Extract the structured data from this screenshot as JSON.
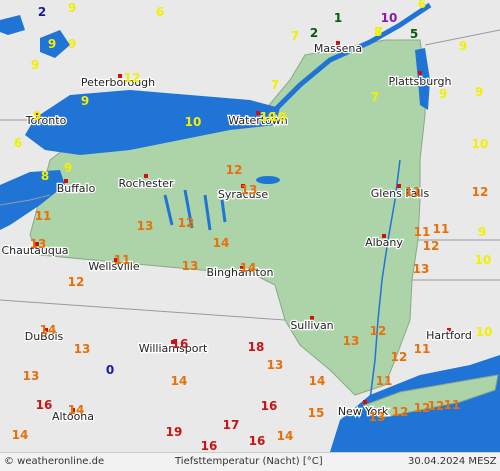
{
  "map": {
    "colors": {
      "water": "#1f74d6",
      "land": "#e9e9e9",
      "state": "#add3a8",
      "border": "#9a9a9a",
      "marker": "#d01010"
    },
    "cities": [
      {
        "name": "Massena",
        "id": "massena"
      },
      {
        "name": "Plattsburgh",
        "id": "plattsburgh"
      },
      {
        "name": "Peterborough",
        "id": "peterborough"
      },
      {
        "name": "Toronto",
        "id": "toronto"
      },
      {
        "name": "Watertown",
        "id": "watertown"
      },
      {
        "name": "Rochester",
        "id": "rochester"
      },
      {
        "name": "Buffalo",
        "id": "buffalo"
      },
      {
        "name": "Syracuse",
        "id": "syracuse"
      },
      {
        "name": "Glens Falls",
        "id": "glens-falls"
      },
      {
        "name": "Albany",
        "id": "albany"
      },
      {
        "name": "Chautauqua",
        "id": "chautauqua"
      },
      {
        "name": "Wellsville",
        "id": "wellsville"
      },
      {
        "name": "Binghamton",
        "id": "binghamton"
      },
      {
        "name": "Sullivan",
        "id": "sullivan"
      },
      {
        "name": "Hartford",
        "id": "hartford"
      },
      {
        "name": "DuBois",
        "id": "dubois"
      },
      {
        "name": "Williamsport",
        "id": "williamsport"
      },
      {
        "name": "Altoona",
        "id": "altoona"
      },
      {
        "name": "New York",
        "id": "new-york"
      }
    ],
    "temperatures": [
      {
        "v": "2",
        "c": "#1a1a8c"
      },
      {
        "v": "9",
        "c": "#f0f000"
      },
      {
        "v": "6",
        "c": "#f0f000"
      },
      {
        "v": "1",
        "c": "#0a5a0a"
      },
      {
        "v": "10",
        "c": "#8c1aa8"
      },
      {
        "v": "6",
        "c": "#f0f000"
      },
      {
        "v": "9",
        "c": "#f0f000"
      },
      {
        "v": "9",
        "c": "#f0f000"
      },
      {
        "v": "9",
        "c": "#f0f000"
      },
      {
        "v": "7",
        "c": "#f0f000"
      },
      {
        "v": "2",
        "c": "#0a5a0a"
      },
      {
        "v": "5",
        "c": "#0a5a0a"
      },
      {
        "v": "7",
        "c": "#f0f000"
      },
      {
        "v": "8",
        "c": "#f0f000"
      },
      {
        "v": "9",
        "c": "#f0f000"
      },
      {
        "v": "12",
        "c": "#f0f000"
      },
      {
        "v": "9",
        "c": "#f0f000"
      },
      {
        "v": "9",
        "c": "#f0f000"
      },
      {
        "v": "6",
        "c": "#f0f000"
      },
      {
        "v": "7",
        "c": "#f0f000"
      },
      {
        "v": "10",
        "c": "#f0f000"
      },
      {
        "v": "10",
        "c": "#f0f000"
      },
      {
        "v": "10",
        "c": "#f0f000"
      },
      {
        "v": "7",
        "c": "#f0f000"
      },
      {
        "v": "9",
        "c": "#f0f000"
      },
      {
        "v": "9",
        "c": "#f0f000"
      },
      {
        "v": "9",
        "c": "#f0f000"
      },
      {
        "v": "8",
        "c": "#f0f000"
      },
      {
        "v": "10",
        "c": "#f0f000"
      },
      {
        "v": "12",
        "c": "#e8700a"
      },
      {
        "v": "13",
        "c": "#e8700a"
      },
      {
        "v": "12",
        "c": "#e8700a"
      },
      {
        "v": "11",
        "c": "#e8700a"
      },
      {
        "v": "11",
        "c": "#e8700a"
      },
      {
        "v": "12",
        "c": "#e8700a"
      },
      {
        "v": "13",
        "c": "#e8700a"
      },
      {
        "v": "12",
        "c": "#e8700a"
      },
      {
        "v": "11",
        "c": "#e8700a"
      },
      {
        "v": "13",
        "c": "#e8700a"
      },
      {
        "v": "14",
        "c": "#e8700a"
      },
      {
        "v": "11",
        "c": "#e8700a"
      },
      {
        "v": "13",
        "c": "#e8700a"
      },
      {
        "v": "9",
        "c": "#f0f000"
      },
      {
        "v": "10",
        "c": "#f0f000"
      },
      {
        "v": "11",
        "c": "#e8700a"
      },
      {
        "v": "13",
        "c": "#e8700a"
      },
      {
        "v": "12",
        "c": "#e8700a"
      },
      {
        "v": "14",
        "c": "#e8700a"
      },
      {
        "v": "13",
        "c": "#e8700a"
      },
      {
        "v": "12",
        "c": "#e8700a"
      },
      {
        "v": "10",
        "c": "#f0f000"
      },
      {
        "v": "14",
        "c": "#e8700a"
      },
      {
        "v": "16",
        "c": "#c81414"
      },
      {
        "v": "18",
        "c": "#c81414"
      },
      {
        "v": "13",
        "c": "#e8700a"
      },
      {
        "v": "11",
        "c": "#e8700a"
      },
      {
        "v": "12",
        "c": "#e8700a"
      },
      {
        "v": "13",
        "c": "#e8700a"
      },
      {
        "v": "0",
        "c": "#1a1aa8"
      },
      {
        "v": "13",
        "c": "#e8700a"
      },
      {
        "v": "14",
        "c": "#e8700a"
      },
      {
        "v": "11",
        "c": "#e8700a"
      },
      {
        "v": "16",
        "c": "#c81414"
      },
      {
        "v": "14",
        "c": "#e8700a"
      },
      {
        "v": "16",
        "c": "#c81414"
      },
      {
        "v": "15",
        "c": "#e8700a"
      },
      {
        "v": "13",
        "c": "#e8700a"
      },
      {
        "v": "12",
        "c": "#e8700a"
      },
      {
        "v": "12",
        "c": "#e8700a"
      },
      {
        "v": "12",
        "c": "#e8700a"
      },
      {
        "v": "11",
        "c": "#e8700a"
      },
      {
        "v": "14",
        "c": "#e8700a"
      },
      {
        "v": "19",
        "c": "#c81414"
      },
      {
        "v": "17",
        "c": "#c81414"
      },
      {
        "v": "16",
        "c": "#c81414"
      },
      {
        "v": "16",
        "c": "#c81414"
      },
      {
        "v": "14",
        "c": "#e8700a"
      },
      {
        "v": "14",
        "c": "#e8700a"
      }
    ]
  },
  "footer": {
    "site": "© weatheronline.de",
    "title": "Tiefsttemperatur (Nacht) [°C]",
    "date": "30.04.2024 MESZ"
  }
}
